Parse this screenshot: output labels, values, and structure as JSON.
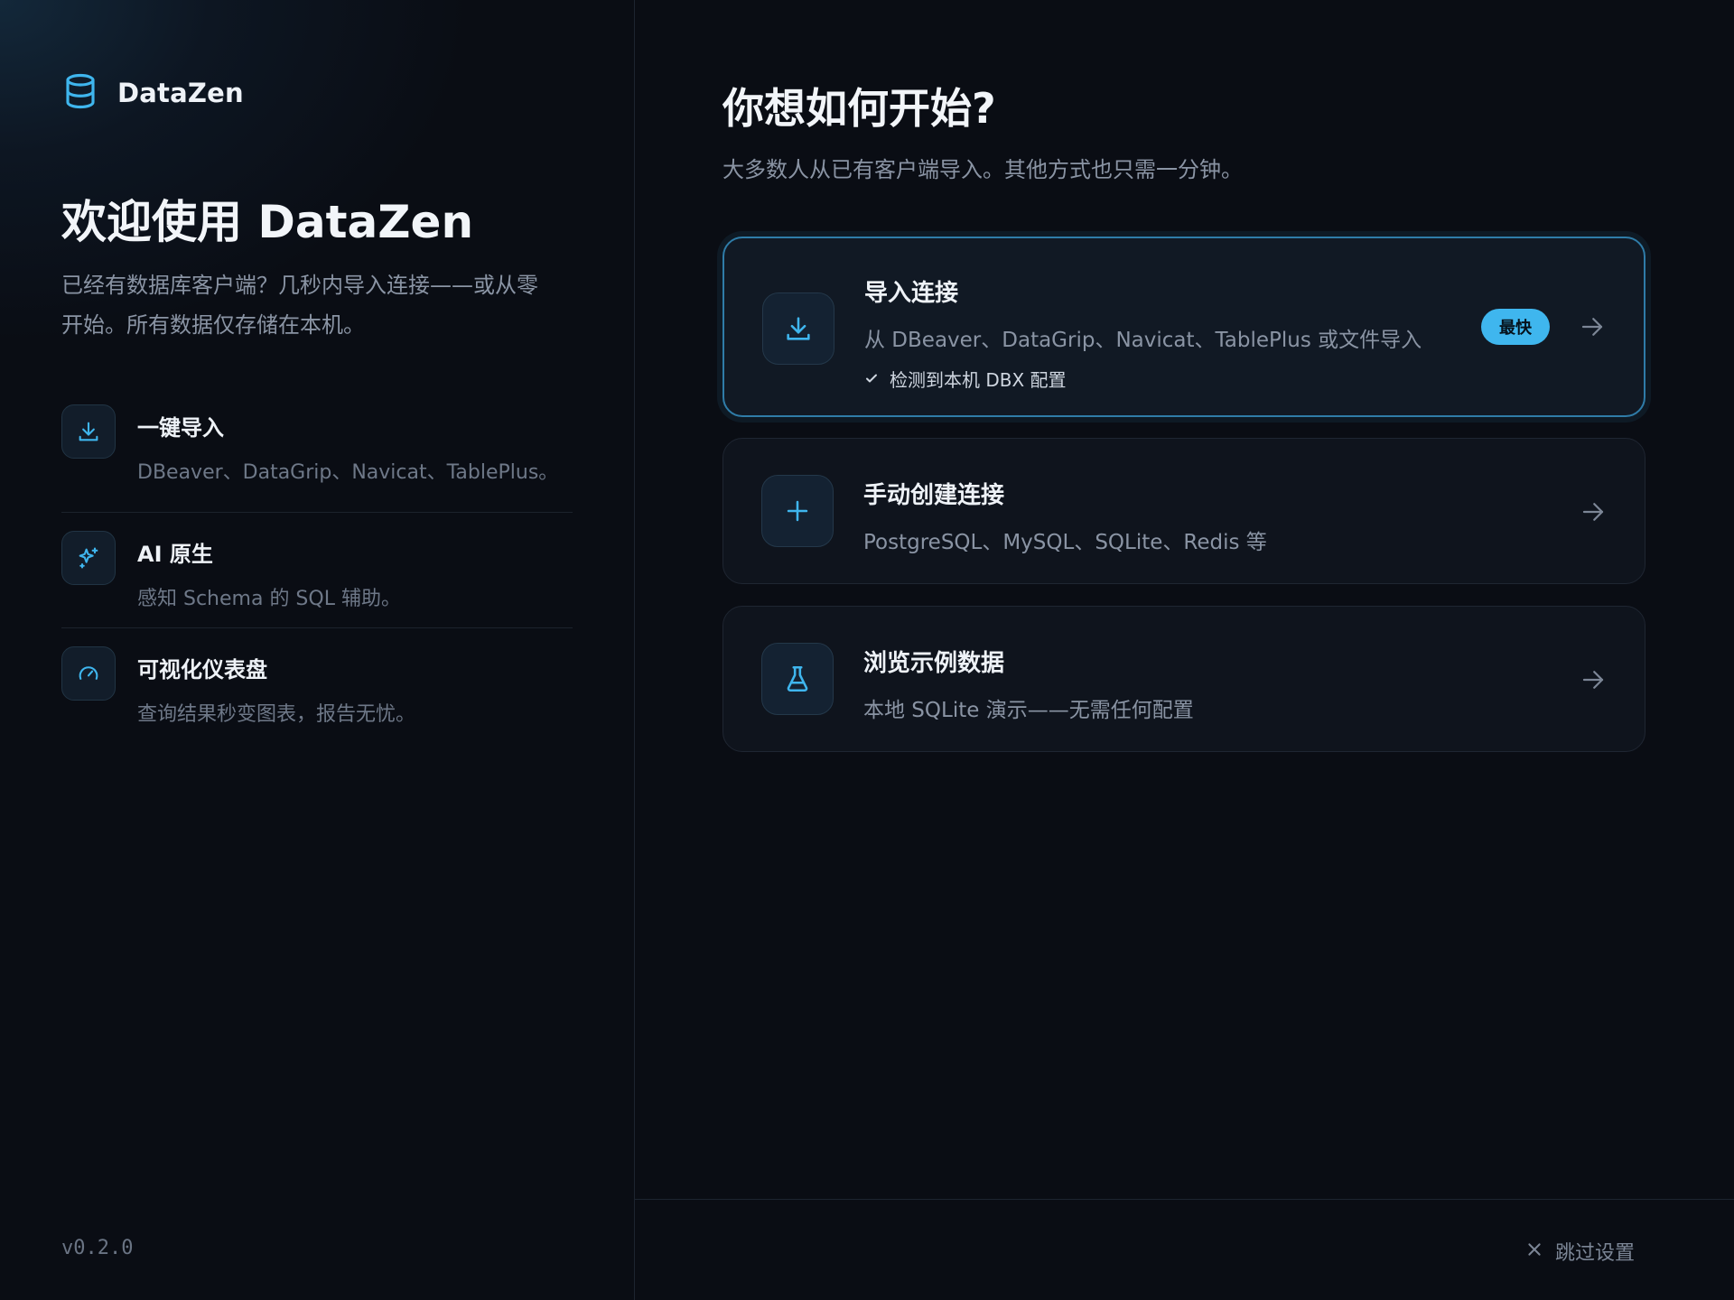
{
  "brand": {
    "name": "DataZen",
    "icon": "database-icon"
  },
  "welcome": {
    "title": "欢迎使用 DataZen",
    "intro": "已经有数据库客户端？几秒内导入连接——或从零开始。所有数据仅存储在本机。"
  },
  "features": [
    {
      "title": "一键导入",
      "desc": "DBeaver、DataGrip、Navicat、TablePlus。",
      "icon": "download-icon"
    },
    {
      "title": "AI 原生",
      "desc": "感知 Schema 的 SQL 辅助。",
      "icon": "sparkle-icon"
    },
    {
      "title": "可视化仪表盘",
      "desc": "查询结果秒变图表，报告无忧。",
      "icon": "gauge-icon"
    }
  ],
  "version": "v0.2.0",
  "main": {
    "title": "你想如何开始?",
    "subtitle": "大多数人从已有客户端导入。其他方式也只需一分钟。",
    "options": [
      {
        "title": "导入连接",
        "desc": "从 DBeaver、DataGrip、Navicat、TablePlus 或文件导入",
        "detected": "检测到本机  DBX  配置",
        "badge": "最快",
        "icon": "download-icon"
      },
      {
        "title": "手动创建连接",
        "desc": "PostgreSQL、MySQL、SQLite、Redis 等",
        "icon": "plus-icon"
      },
      {
        "title": "浏览示例数据",
        "desc": "本地 SQLite 演示——无需任何配置",
        "icon": "flask-icon"
      }
    ]
  },
  "footer": {
    "skip_label": "跳过设置"
  },
  "colors": {
    "accent": "#3fb6ee",
    "background": "#0a0d14",
    "card_border_active": "#2f7ca8"
  }
}
